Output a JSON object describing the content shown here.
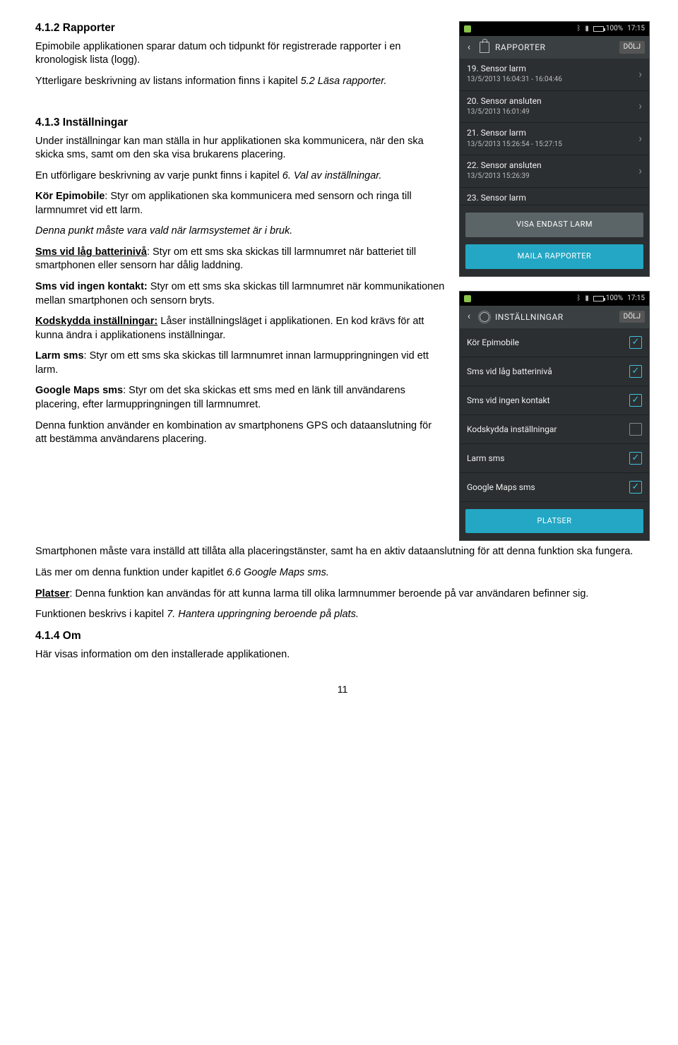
{
  "sections": {
    "s412_title": "4.1.2 Rapporter",
    "s412_p1": "Epimobile applikationen sparar datum och tidpunkt för registrerade rapporter i en kronologisk lista (logg).",
    "s412_p2a": "Ytterligare beskrivning av listans information finns i kapitel ",
    "s412_p2b": "5.2 Läsa rapporter.",
    "s413_title": "4.1.3 Inställningar",
    "s413_p1": "Under inställningar kan man ställa in hur applikationen ska kommunicera, när den ska skicka sms, samt om den ska visa brukarens placering.",
    "s413_p2a": "En utförligare beskrivning av varje punkt finns i kapitel ",
    "s413_p2b": "6. Val av inställningar.",
    "kor_label": "Kör Epimobile",
    "kor_text": ": Styr om applikationen ska kommunicera med sensorn och ringa till larmnumret vid ett larm.",
    "kor_note": "Denna punkt måste vara vald när larmsystemet är i bruk.",
    "smslow_label": "Sms vid låg batterinivå",
    "smslow_text": ": Styr om ett sms ska skickas till larmnumret när batteriet till smartphonen eller sensorn har dålig laddning.",
    "smsnone_label": "Sms vid ingen kontakt:",
    "smsnone_text": " Styr om ett sms ska skickas till larmnumret när kommunikationen mellan smartphonen och sensorn bryts.",
    "kod_label": "Kodskydda inställningar:",
    "kod_text": " Låser inställningsläget i applikationen. En kod krävs för att kunna ändra i applikationens inställningar.",
    "larm_label": "Larm sms",
    "larm_text": ": Styr om ett sms ska skickas till larmnumret innan larmuppringningen vid ett larm.",
    "gmaps_label": "Google Maps sms",
    "gmaps_text": ": Styr om det ska skickas ett sms med en länk till användarens placering, efter larmuppringningen till larmnumret.",
    "gmaps_p2": "Denna funktion använder en kombination av smartphonens GPS och dataanslutning för att bestämma användarens placering.",
    "wide1": "Smartphonen måste vara inställd att tillåta alla placeringstänster, samt ha en aktiv dataanslutning för att denna funktion ska fungera.",
    "wide2a": "Läs mer om denna funktion under kapitlet ",
    "wide2b": "6.6 Google Maps sms.",
    "platser_label": "Platser",
    "platser_text": ": Denna funktion kan användas för att kunna larma till olika larmnummer beroende på var användaren befinner sig.",
    "platser_p2a": "Funktionen beskrivs i kapitel ",
    "platser_p2b": "7. Hantera uppringning beroende på plats.",
    "s414_title": "4.1.4 Om",
    "s414_p1": "Här visas information om den installerade applikationen."
  },
  "status": {
    "battery": "100%",
    "time": "17:15"
  },
  "appbar": {
    "reports_title": "RAPPORTER",
    "settings_title": "INSTÄLLNINGAR",
    "action": "DÖLJ"
  },
  "reports": [
    {
      "title": "19. Sensor larm",
      "sub": "13/5/2013 16:04:31 - 16:04:46"
    },
    {
      "title": "20. Sensor ansluten",
      "sub": "13/5/2013 16:01:49"
    },
    {
      "title": "21. Sensor larm",
      "sub": "13/5/2013 15:26:54 - 15:27:15"
    },
    {
      "title": "22. Sensor ansluten",
      "sub": "13/5/2013 15:26:39"
    },
    {
      "title": "23. Sensor larm",
      "sub": ""
    }
  ],
  "buttons": {
    "only_alarms": "VISA ENDAST LARM",
    "mail_reports": "MAILA RAPPORTER",
    "places": "PLATSER"
  },
  "settings": [
    {
      "label": "Kör Epimobile",
      "checked": true
    },
    {
      "label": "Sms vid låg batterinivå",
      "checked": true
    },
    {
      "label": "Sms vid ingen kontakt",
      "checked": true
    },
    {
      "label": "Kodskydda inställningar",
      "checked": false
    },
    {
      "label": "Larm sms",
      "checked": true
    },
    {
      "label": "Google Maps sms",
      "checked": true
    }
  ],
  "page_number": "11"
}
